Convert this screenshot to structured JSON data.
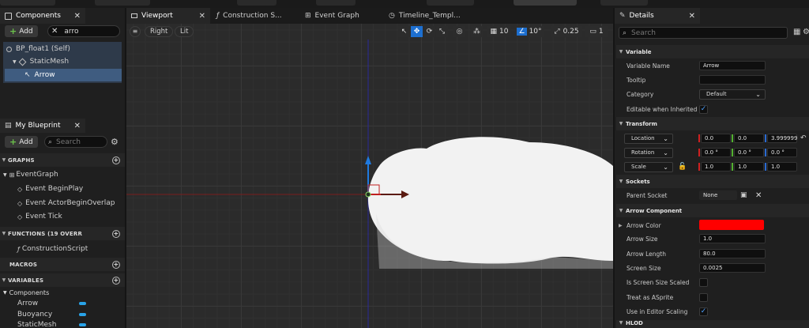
{
  "components_panel": {
    "title": "Components",
    "add_label": "Add",
    "search_value": "arro",
    "tree": [
      {
        "label": "BP_float1 (Self)"
      },
      {
        "label": "StaticMesh"
      },
      {
        "label": "Arrow"
      }
    ]
  },
  "blueprint_panel": {
    "title": "My Blueprint",
    "add_label": "Add",
    "search_placeholder": "Search",
    "graphs_header": "GRAPHS",
    "event_graph": "EventGraph",
    "events": [
      "Event BeginPlay",
      "Event ActorBeginOverlap",
      "Event Tick"
    ],
    "functions_header": "FUNCTIONS (19 OVERR",
    "construction_script": "ConstructionScript",
    "macros_header": "MACROS",
    "variables_header": "VARIABLES",
    "components_group": "Components",
    "variables": [
      "Arrow",
      "Buoyancy",
      "StaticMesh"
    ],
    "var_color": "#29a3e8"
  },
  "tabs": [
    {
      "label": "Viewport"
    },
    {
      "label": "Construction S..."
    },
    {
      "label": "Event Graph"
    },
    {
      "label": "Timeline_Templ..."
    }
  ],
  "viewport": {
    "view_mode": "Right",
    "lighting": "Lit",
    "grid_snap": "10",
    "rotation_snap": "10°",
    "scale_snap": "0.25",
    "camera_speed": "1"
  },
  "details": {
    "title": "Details",
    "search_placeholder": "Search",
    "sections": {
      "variable": "Variable",
      "transform": "Transform",
      "sockets": "Sockets",
      "arrow_component": "Arrow Component",
      "hlod": "HLOD"
    },
    "variable_name_label": "Variable Name",
    "variable_name": "Arrow",
    "tooltip_label": "Tooltip",
    "tooltip_value": "",
    "category_label": "Category",
    "category_value": "Default",
    "editable_label": "Editable when Inherited",
    "location_label": "Location",
    "location": [
      "0.0",
      "0.0",
      "3.999999"
    ],
    "rotation_label": "Rotation",
    "rotation": [
      "0.0 °",
      "0.0 °",
      "0.0 °"
    ],
    "scale_label": "Scale",
    "scale": [
      "1.0",
      "1.0",
      "1.0"
    ],
    "parent_socket_label": "Parent Socket",
    "parent_socket_value": "None",
    "arrow_color_label": "Arrow Color",
    "arrow_color": "#ff0000",
    "arrow_size_label": "Arrow Size",
    "arrow_size": "1.0",
    "arrow_length_label": "Arrow Length",
    "arrow_length": "80.0",
    "screen_size_label": "Screen Size",
    "screen_size": "0.0025",
    "screen_size_scaled_label": "Is Screen Size Scaled",
    "treat_as_sprite_label": "Treat as ASprite",
    "editor_scaling_label": "Use in Editor Scaling"
  }
}
